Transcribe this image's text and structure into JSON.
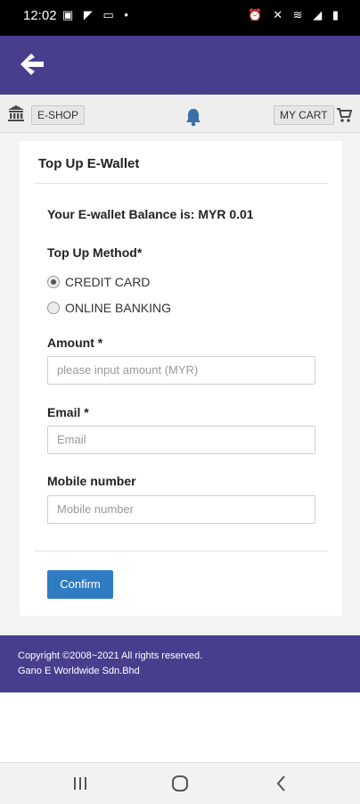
{
  "status_bar": {
    "time": "12:02",
    "left_icons": "▣ ◤ ▭ •",
    "right_icons": "⏰ ✕ ≋ ◢ ▮"
  },
  "toolbar": {
    "eshop_label": "E-SHOP",
    "mycart_label": "MY CART"
  },
  "card": {
    "title": "Top Up E-Wallet",
    "balance_text": "Your E-wallet Balance is: MYR 0.01",
    "method_label": "Top Up Method*",
    "methods": [
      {
        "label": "CREDIT CARD",
        "selected": true
      },
      {
        "label": "ONLINE BANKING",
        "selected": false
      }
    ],
    "amount_label": "Amount *",
    "amount_placeholder": "please input amount (MYR)",
    "email_label": "Email *",
    "email_placeholder": "Email",
    "mobile_label": "Mobile number",
    "mobile_placeholder": "Mobile number",
    "confirm_label": "Confirm"
  },
  "footer": {
    "line1": "Copyright ©2008~2021 All rights reserved.",
    "line2": "Gano E Worldwide Sdn.Bhd"
  },
  "colors": {
    "brand": "#473f8e",
    "confirm": "#2f7cc2"
  },
  "icons": [
    "back-arrow-icon",
    "bank-icon",
    "bell-icon",
    "cart-icon",
    "recent-apps-icon",
    "home-icon",
    "back-nav-icon"
  ]
}
